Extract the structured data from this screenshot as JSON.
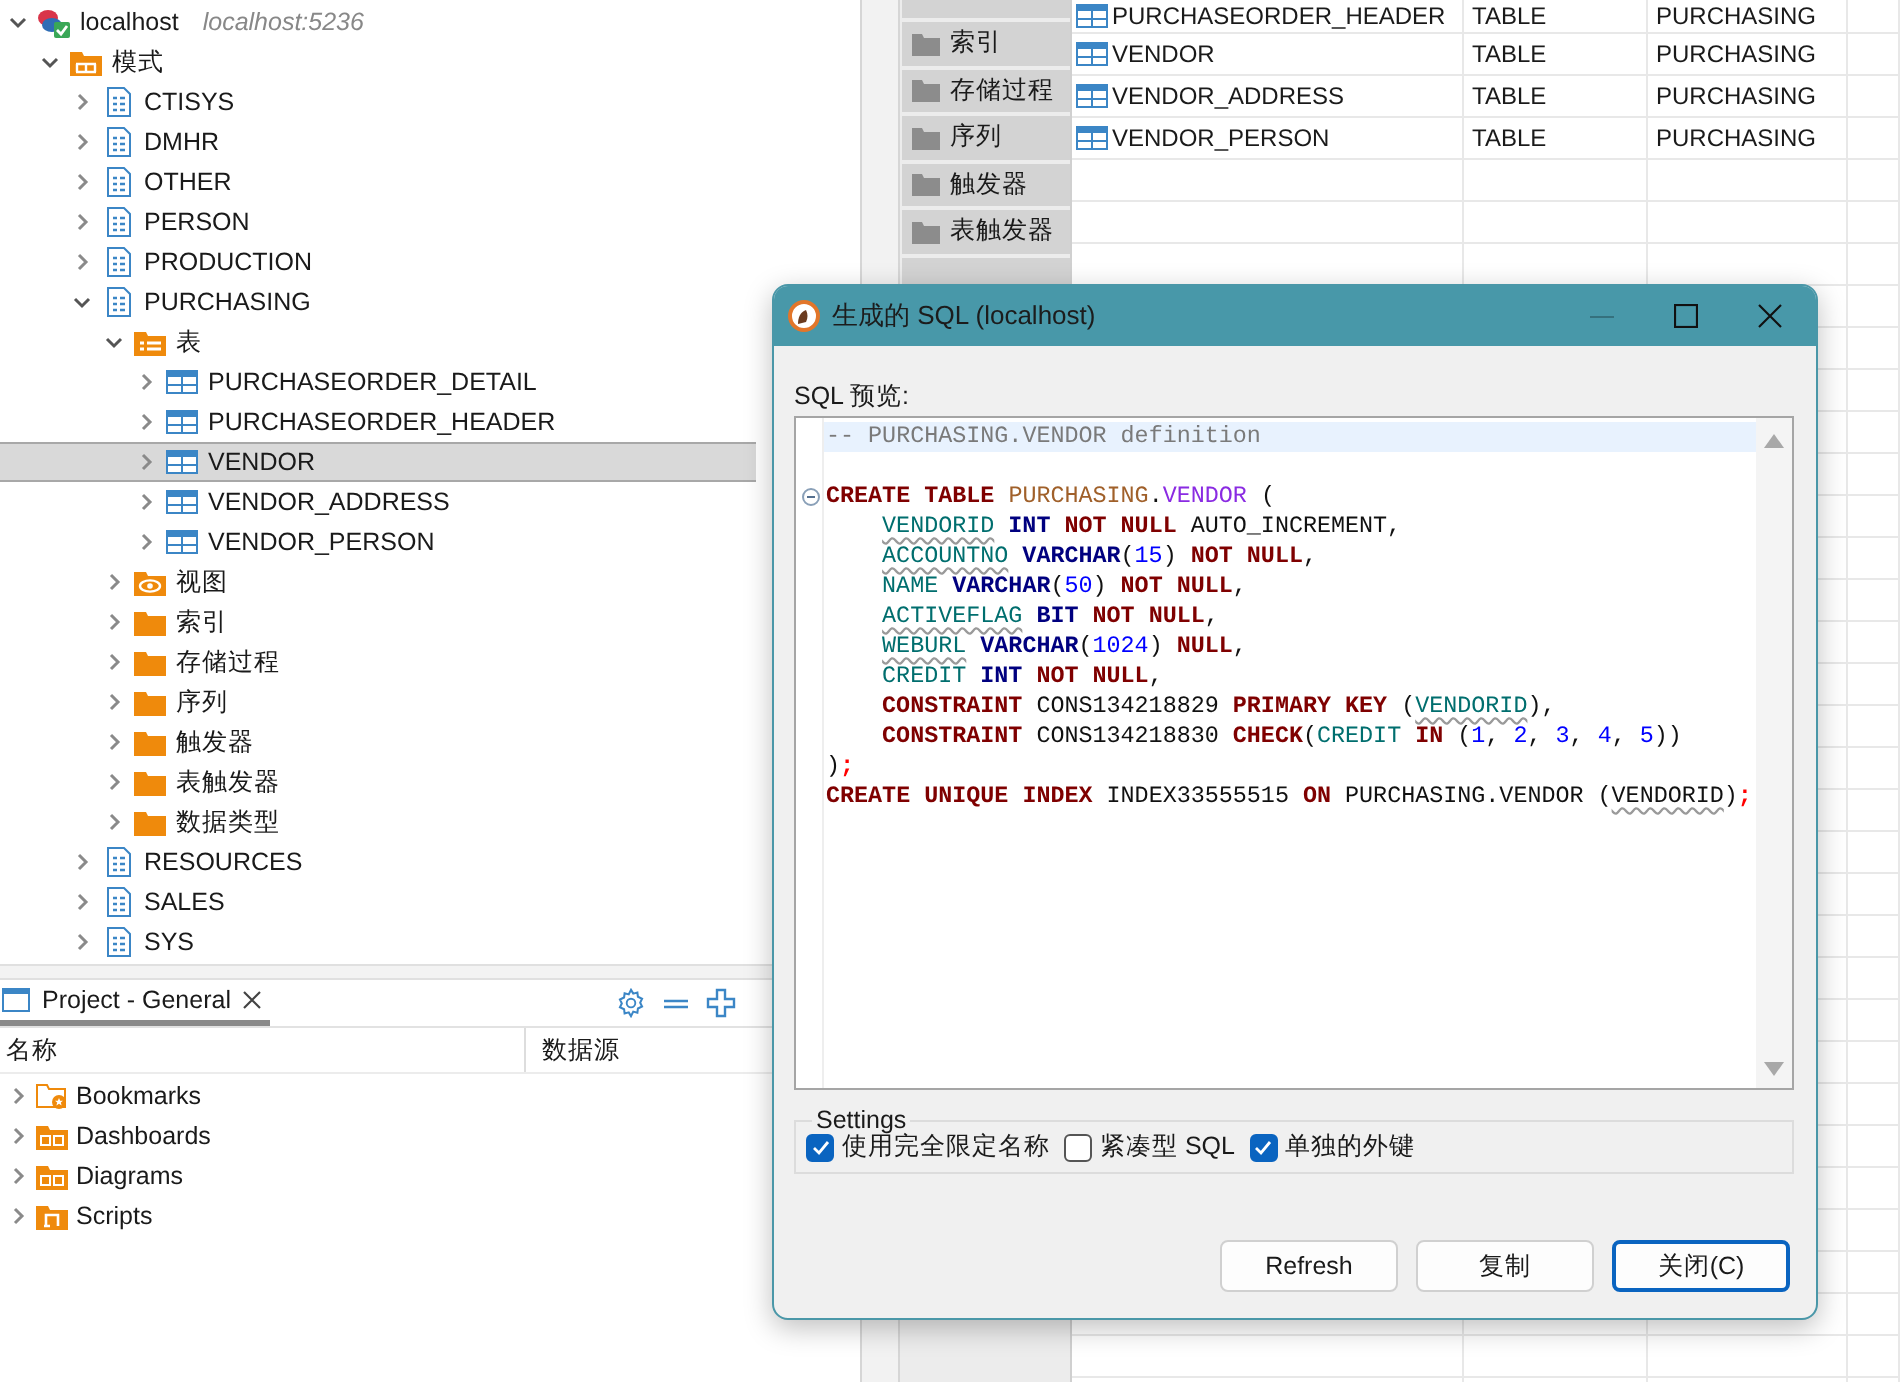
{
  "tree": [
    {
      "label": "localhost",
      "subtitle": "localhost:5236",
      "kind": "connection",
      "expanded": true,
      "selected": false,
      "children": [
        {
          "label": "模式",
          "kind": "schemas",
          "expanded": true,
          "selected": false,
          "children": [
            {
              "label": "CTISYS",
              "kind": "schema",
              "expanded": false,
              "selected": false
            },
            {
              "label": "DMHR",
              "kind": "schema",
              "expanded": false,
              "selected": false
            },
            {
              "label": "OTHER",
              "kind": "schema",
              "expanded": false,
              "selected": false
            },
            {
              "label": "PERSON",
              "kind": "schema",
              "expanded": false,
              "selected": false
            },
            {
              "label": "PRODUCTION",
              "kind": "schema",
              "expanded": false,
              "selected": false
            },
            {
              "label": "PURCHASING",
              "kind": "schema",
              "expanded": true,
              "selected": false,
              "children": [
                {
                  "label": "表",
                  "kind": "tables",
                  "expanded": true,
                  "selected": false,
                  "children": [
                    {
                      "label": "PURCHASEORDER_DETAIL",
                      "kind": "table",
                      "expanded": false,
                      "selected": false
                    },
                    {
                      "label": "PURCHASEORDER_HEADER",
                      "kind": "table",
                      "expanded": false,
                      "selected": false
                    },
                    {
                      "label": "VENDOR",
                      "kind": "table",
                      "expanded": false,
                      "selected": true
                    },
                    {
                      "label": "VENDOR_ADDRESS",
                      "kind": "table",
                      "expanded": false,
                      "selected": false
                    },
                    {
                      "label": "VENDOR_PERSON",
                      "kind": "table",
                      "expanded": false,
                      "selected": false
                    }
                  ]
                },
                {
                  "label": "视图",
                  "kind": "views",
                  "expanded": false,
                  "selected": false
                },
                {
                  "label": "索引",
                  "kind": "folder",
                  "expanded": false,
                  "selected": false
                },
                {
                  "label": "存储过程",
                  "kind": "folder",
                  "expanded": false,
                  "selected": false
                },
                {
                  "label": "序列",
                  "kind": "folder",
                  "expanded": false,
                  "selected": false
                },
                {
                  "label": "触发器",
                  "kind": "folder",
                  "expanded": false,
                  "selected": false
                },
                {
                  "label": "表触发器",
                  "kind": "folder",
                  "expanded": false,
                  "selected": false
                },
                {
                  "label": "数据类型",
                  "kind": "folder",
                  "expanded": false,
                  "selected": false
                }
              ]
            },
            {
              "label": "RESOURCES",
              "kind": "schema",
              "expanded": false,
              "selected": false
            },
            {
              "label": "SALES",
              "kind": "schema",
              "expanded": false,
              "selected": false
            },
            {
              "label": "SYS",
              "kind": "schema",
              "expanded": false,
              "selected": false
            }
          ]
        }
      ]
    }
  ],
  "project": {
    "tab": {
      "label": "Project - General",
      "selected": true
    },
    "columns": [
      "名称",
      "数据源"
    ],
    "items": [
      {
        "label": "Bookmarks",
        "kind": "bookmarks",
        "expanded": false
      },
      {
        "label": "Dashboards",
        "kind": "dashboards",
        "expanded": false
      },
      {
        "label": "Diagrams",
        "kind": "diagrams",
        "expanded": false
      },
      {
        "label": "Scripts",
        "kind": "scripts",
        "expanded": false
      }
    ]
  },
  "object_browser": {
    "side_tabs": [
      "索引",
      "存储过程",
      "序列",
      "触发器",
      "表触发器"
    ],
    "rows": [
      {
        "name": "PURCHASEORDER_HEADER",
        "type": "TABLE",
        "schema": "PURCHASING"
      },
      {
        "name": "VENDOR",
        "type": "TABLE",
        "schema": "PURCHASING"
      },
      {
        "name": "VENDOR_ADDRESS",
        "type": "TABLE",
        "schema": "PURCHASING"
      },
      {
        "name": "VENDOR_PERSON",
        "type": "TABLE",
        "schema": "PURCHASING"
      }
    ]
  },
  "dialog": {
    "title": "生成的 SQL (localhost)",
    "window_controls": [
      {
        "kind": "minimize",
        "disabled": true
      },
      {
        "kind": "maximize",
        "disabled": false
      },
      {
        "kind": "close",
        "disabled": false
      }
    ],
    "preview_label": "SQL 预览:",
    "lines": [
      {
        "highlighted": true,
        "tokens": [
          {
            "kind": "comment",
            "text": "-- PURCHASING.VENDOR definition"
          }
        ]
      },
      {
        "highlighted": false
      },
      {
        "fold": true,
        "tokens": [
          {
            "kind": "keyword",
            "text": "CREATE TABLE "
          },
          {
            "kind": "schema",
            "text": "PURCHASING"
          },
          {
            "kind": "plain",
            "text": "."
          },
          {
            "kind": "table",
            "text": "VENDOR"
          },
          {
            "kind": "plain",
            "text": " ("
          }
        ]
      },
      {
        "indent": true,
        "tokens": [
          {
            "kind": "column",
            "text": "VENDORID",
            "wavy": true
          },
          {
            "kind": "type",
            "text": " INT"
          },
          {
            "kind": "keyword",
            "text": " NOT NULL"
          },
          {
            "kind": "plain",
            "text": " AUTO_INCREMENT,"
          }
        ]
      },
      {
        "indent": true,
        "tokens": [
          {
            "kind": "column",
            "text": "ACCOUNTNO",
            "wavy": true
          },
          {
            "kind": "type",
            "text": " VARCHAR"
          },
          {
            "kind": "plain",
            "text": "("
          },
          {
            "kind": "number",
            "text": "15"
          },
          {
            "kind": "plain",
            "text": ")"
          },
          {
            "kind": "keyword",
            "text": " NOT NULL"
          },
          {
            "kind": "plain",
            "text": ","
          }
        ]
      },
      {
        "indent": true,
        "tokens": [
          {
            "kind": "column",
            "text": "NAME"
          },
          {
            "kind": "type",
            "text": " VARCHAR"
          },
          {
            "kind": "plain",
            "text": "("
          },
          {
            "kind": "number",
            "text": "50"
          },
          {
            "kind": "plain",
            "text": ")"
          },
          {
            "kind": "keyword",
            "text": " NOT NULL"
          },
          {
            "kind": "plain",
            "text": ","
          }
        ]
      },
      {
        "indent": true,
        "tokens": [
          {
            "kind": "column",
            "text": "ACTIVEFLAG",
            "wavy": true
          },
          {
            "kind": "type",
            "text": " BIT"
          },
          {
            "kind": "keyword",
            "text": " NOT NULL"
          },
          {
            "kind": "plain",
            "text": ","
          }
        ]
      },
      {
        "indent": true,
        "tokens": [
          {
            "kind": "column",
            "text": "WEBURL",
            "wavy": true
          },
          {
            "kind": "type",
            "text": " VARCHAR"
          },
          {
            "kind": "plain",
            "text": "("
          },
          {
            "kind": "number",
            "text": "1024"
          },
          {
            "kind": "plain",
            "text": ")"
          },
          {
            "kind": "keyword",
            "text": " NULL"
          },
          {
            "kind": "plain",
            "text": ","
          }
        ]
      },
      {
        "indent": true,
        "tokens": [
          {
            "kind": "column",
            "text": "CREDIT"
          },
          {
            "kind": "type",
            "text": " INT"
          },
          {
            "kind": "keyword",
            "text": " NOT NULL"
          },
          {
            "kind": "plain",
            "text": ","
          }
        ]
      },
      {
        "indent": true,
        "tokens": [
          {
            "kind": "keyword",
            "text": "CONSTRAINT"
          },
          {
            "kind": "plain",
            "text": " CONS134218829 "
          },
          {
            "kind": "keyword",
            "text": "PRIMARY KEY"
          },
          {
            "kind": "plain",
            "text": " ("
          },
          {
            "kind": "column",
            "text": "VENDORID",
            "wavy": true
          },
          {
            "kind": "plain",
            "text": "),"
          }
        ]
      },
      {
        "indent": true,
        "tokens": [
          {
            "kind": "keyword",
            "text": "CONSTRAINT"
          },
          {
            "kind": "plain",
            "text": " CONS134218830 "
          },
          {
            "kind": "keyword",
            "text": "CHECK"
          },
          {
            "kind": "plain",
            "text": "("
          },
          {
            "kind": "column",
            "text": "CREDIT"
          },
          {
            "kind": "keyword",
            "text": " IN"
          },
          {
            "kind": "plain",
            "text": " ("
          },
          {
            "kind": "number",
            "text": "1"
          },
          {
            "kind": "plain",
            "text": ", "
          },
          {
            "kind": "number",
            "text": "2"
          },
          {
            "kind": "plain",
            "text": ", "
          },
          {
            "kind": "number",
            "text": "3"
          },
          {
            "kind": "plain",
            "text": ", "
          },
          {
            "kind": "number",
            "text": "4"
          },
          {
            "kind": "plain",
            "text": ", "
          },
          {
            "kind": "number",
            "text": "5"
          },
          {
            "kind": "plain",
            "text": "))"
          }
        ]
      },
      {
        "tokens": [
          {
            "kind": "plain",
            "text": ")"
          },
          {
            "kind": "semicolon",
            "text": ";"
          }
        ]
      },
      {
        "tokens": [
          {
            "kind": "keyword",
            "text": "CREATE UNIQUE INDEX"
          },
          {
            "kind": "plain",
            "text": " INDEX33555515 "
          },
          {
            "kind": "keyword",
            "text": "ON"
          },
          {
            "kind": "plain",
            "text": " PURCHASING.VENDOR ("
          },
          {
            "kind": "plain",
            "text": "VENDORID",
            "wavy": true
          },
          {
            "kind": "plain",
            "text": ")"
          },
          {
            "kind": "semicolon",
            "text": ";"
          }
        ]
      }
    ],
    "settings_label": "Settings",
    "options": [
      {
        "label": "使用完全限定名称",
        "checked": true
      },
      {
        "label": "紧凑型 SQL",
        "checked": false
      },
      {
        "label": "单独的外键",
        "checked": true
      }
    ],
    "buttons": [
      {
        "label": "Refresh",
        "default": false
      },
      {
        "label": "复制",
        "default": false
      },
      {
        "label": "关闭(C)",
        "default": true
      }
    ]
  }
}
